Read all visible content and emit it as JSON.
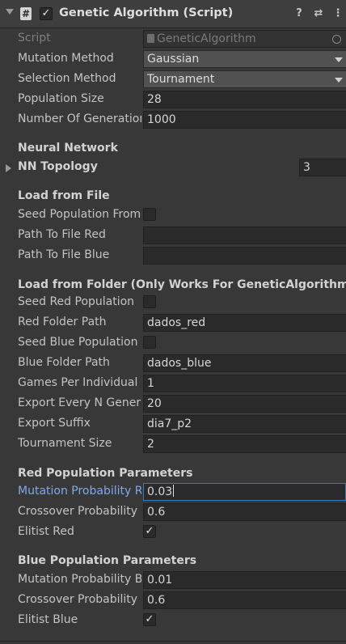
{
  "header": {
    "title": "Genetic Algorithm (Script)",
    "enabled": true,
    "icons": [
      "foldout-arrow-icon",
      "script-icon",
      "help-icon",
      "preset-icon",
      "more-icon"
    ]
  },
  "script": {
    "label": "Script",
    "value": "GeneticAlgorithm"
  },
  "mutation_method": {
    "label": "Mutation Method",
    "value": "Gaussian"
  },
  "selection_method": {
    "label": "Selection Method",
    "value": "Tournament"
  },
  "population_size": {
    "label": "Population Size",
    "value": "28"
  },
  "number_of_generations": {
    "label": "Number Of Generations",
    "value": "1000"
  },
  "neural_network": {
    "header": "Neural Network",
    "nn_topology": {
      "label": "NN Topology",
      "value": "3"
    }
  },
  "load_from_file": {
    "header": "Load from File",
    "seed_population": {
      "label": "Seed Population From File",
      "checked": false
    },
    "path_red": {
      "label": "Path To File Red",
      "value": ""
    },
    "path_blue": {
      "label": "Path To File Blue",
      "value": ""
    }
  },
  "load_from_folder": {
    "header": "Load from Folder (Only Works For GeneticAlgorithm)",
    "seed_red": {
      "label": "Seed Red Population",
      "checked": false
    },
    "red_folder_path": {
      "label": "Red Folder Path",
      "value": "dados_red"
    },
    "seed_blue": {
      "label": "Seed Blue Population",
      "checked": false
    },
    "blue_folder_path": {
      "label": "Blue Folder Path",
      "value": "dados_blue"
    },
    "games_per_individual": {
      "label": "Games Per Individual",
      "value": "1"
    },
    "export_every": {
      "label": "Export Every N Generations",
      "value": "20"
    },
    "export_suffix": {
      "label": "Export Suffix",
      "value": "dia7_p2"
    },
    "tournament_size": {
      "label": "Tournament Size",
      "value": "2"
    }
  },
  "red_params": {
    "header": "Red Population Parameters",
    "mutation_probability": {
      "label": "Mutation Probability Red",
      "value": "0.03"
    },
    "crossover_probability": {
      "label": "Crossover Probability Red",
      "value": "0.6"
    },
    "elitist": {
      "label": "Elitist Red",
      "checked": true
    }
  },
  "blue_params": {
    "header": "Blue Population Parameters",
    "mutation_probability": {
      "label": "Mutation Probability Blue",
      "value": "0.01"
    },
    "crossover_probability": {
      "label": "Crossover Probability Blue",
      "value": "0.6"
    },
    "elitist": {
      "label": "Elitist Blue",
      "checked": true
    }
  },
  "glyphs": {
    "check": "✓",
    "help": "?",
    "preset": "⇄",
    "more": "⋮",
    "script": "#"
  }
}
